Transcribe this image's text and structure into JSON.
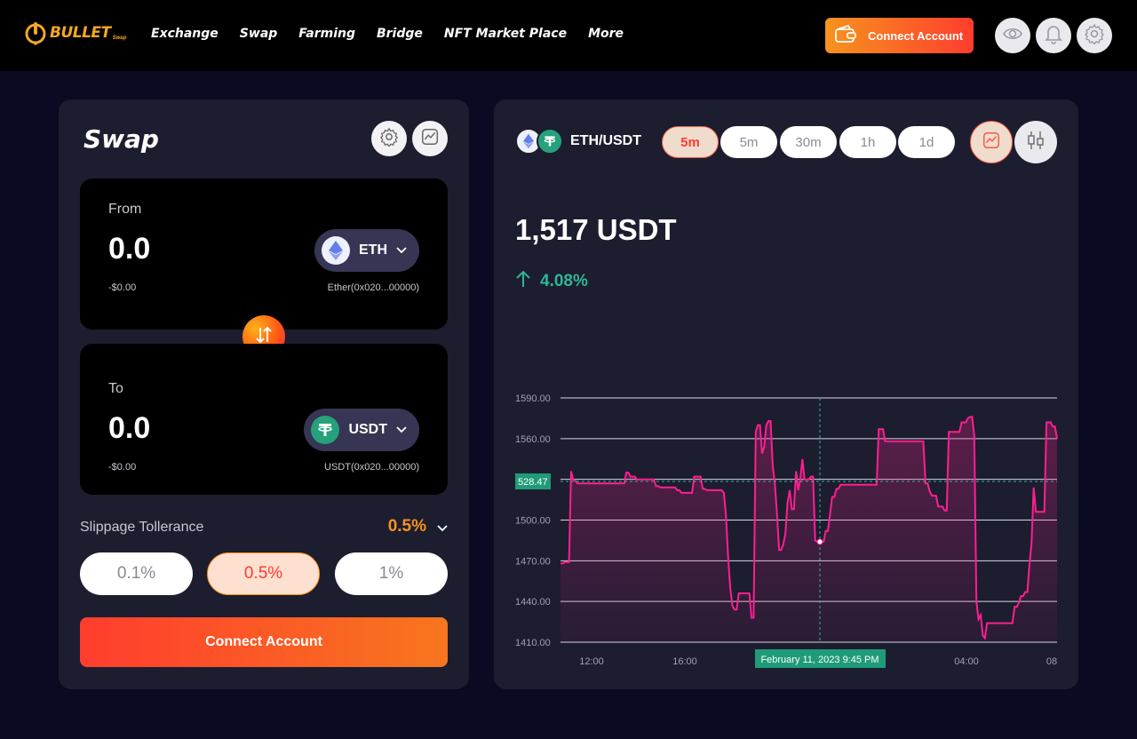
{
  "header": {
    "logo_text": "BULLET",
    "logo_sub": "Swap",
    "nav": [
      "Exchange",
      "Swap",
      "Farming",
      "Bridge",
      "NFT Market Place",
      "More"
    ],
    "connect_label": "Connect Account"
  },
  "swap": {
    "title": "Swap",
    "from": {
      "label": "From",
      "amount": "0.0",
      "usd": "-$0.00",
      "token": "ETH",
      "address": "Ether(0x020...00000)"
    },
    "to": {
      "label": "To",
      "amount": "0.0",
      "usd": "-$0.00",
      "token": "USDT",
      "address": "USDT(0x020...00000)"
    },
    "slippage_label": "Slippage Tollerance",
    "slippage_value": "0.5%",
    "slippage_options": [
      "0.1%",
      "0.5%",
      "1%"
    ],
    "connect_label": "Connect Account"
  },
  "chart_panel": {
    "pair": "ETH/USDT",
    "timeframes": [
      "5m",
      "5m",
      "30m",
      "1h",
      "1d"
    ],
    "price": "1,517 USDT",
    "change": "4.08%"
  },
  "chart_data": {
    "type": "area",
    "y_ticks": [
      "1590.00",
      "1560.00",
      "1530.00",
      "1500.00",
      "1470.00",
      "1440.00",
      "1410.00"
    ],
    "x_ticks": [
      "12:00",
      "16:00",
      "",
      "04:00",
      "08"
    ],
    "crosshair_y_label": "528.47",
    "crosshair_x_label": "February 11, 2023 9:45 PM",
    "ylim": [
      1410,
      1590
    ],
    "series_color": "#ff1f8e",
    "values": [
      1468,
      1468,
      1469,
      1469,
      1469,
      1536,
      1530,
      1529,
      1527,
      1527,
      1527,
      1527,
      1527,
      1527,
      1527,
      1527,
      1527,
      1527,
      1527,
      1527,
      1527,
      1527,
      1527,
      1527,
      1527,
      1527,
      1527,
      1527,
      1527,
      1527,
      1527,
      1535,
      1535,
      1532,
      1532,
      1532,
      1530,
      1530,
      1530,
      1530,
      1530,
      1530,
      1530,
      1530,
      1530,
      1525,
      1525,
      1524,
      1524,
      1524,
      1524,
      1524,
      1524,
      1524,
      1524,
      1522,
      1522,
      1520,
      1520,
      1520,
      1520,
      1520,
      1520,
      1532,
      1532,
      1532,
      1532,
      1523,
      1523,
      1522,
      1522,
      1522,
      1522,
      1522,
      1522,
      1522,
      1522,
      1520,
      1503,
      1473,
      1450,
      1437,
      1434,
      1434,
      1446,
      1446,
      1446,
      1446,
      1446,
      1446,
      1428,
      1428,
      1565,
      1570,
      1570,
      1549,
      1554,
      1570,
      1573,
      1573,
      1540,
      1527,
      1505,
      1478,
      1478,
      1482,
      1490,
      1513,
      1522,
      1508,
      1508,
      1536,
      1522,
      1530,
      1545,
      1530,
      1530,
      1530,
      1532,
      1532,
      1485,
      1484,
      1484,
      1484,
      1484,
      1492,
      1492,
      1504,
      1517,
      1517,
      1523,
      1523,
      1526,
      1526,
      1526,
      1526,
      1526,
      1526,
      1526,
      1526,
      1526,
      1526,
      1526,
      1526,
      1526,
      1526,
      1526,
      1526,
      1526,
      1526,
      1567,
      1567,
      1567,
      1558,
      1558,
      1558,
      1558,
      1558,
      1558,
      1558,
      1558,
      1558,
      1558,
      1558,
      1558,
      1558,
      1558,
      1558,
      1558,
      1558,
      1558,
      1558,
      1527,
      1527,
      1521,
      1518,
      1518,
      1518,
      1510,
      1510,
      1510,
      1507,
      1507,
      1565,
      1565,
      1565,
      1565,
      1565,
      1565,
      1572,
      1572,
      1572,
      1575,
      1576,
      1576,
      1562,
      1440,
      1427,
      1430,
      1415,
      1413,
      1424,
      1424,
      1424,
      1424,
      1424,
      1424,
      1424,
      1424,
      1424,
      1424,
      1424,
      1424,
      1424,
      1436,
      1436,
      1439,
      1444,
      1444,
      1447,
      1447,
      1467,
      1483,
      1524,
      1506,
      1506,
      1506,
      1506,
      1506,
      1572,
      1572,
      1572,
      1569,
      1569,
      1560
    ]
  }
}
